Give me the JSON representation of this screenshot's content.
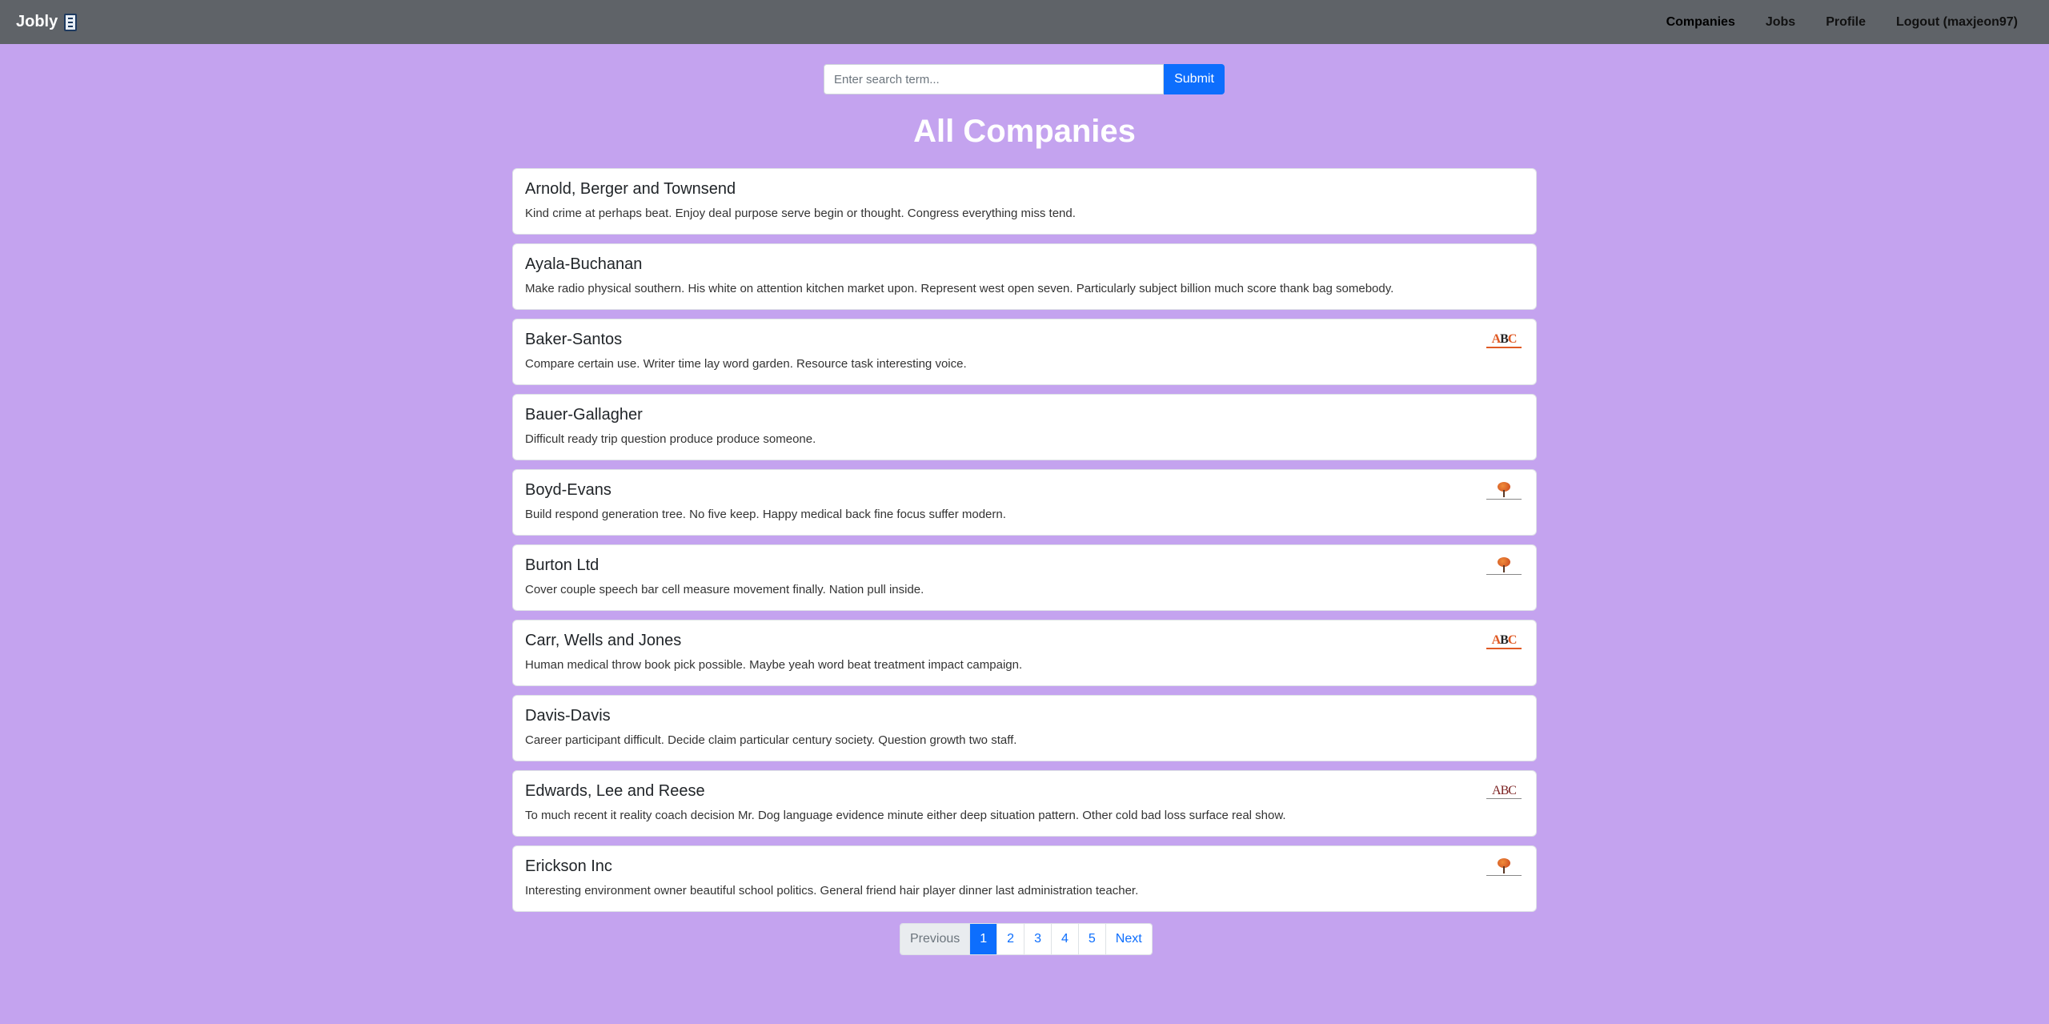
{
  "navbar": {
    "brand": "Jobly",
    "links": [
      {
        "label": "Companies"
      },
      {
        "label": "Jobs"
      },
      {
        "label": "Profile"
      },
      {
        "label": "Logout (maxjeon97)"
      }
    ]
  },
  "search": {
    "placeholder": "Enter search term...",
    "value": "",
    "submit_label": "Submit"
  },
  "page": {
    "title": "All Companies"
  },
  "companies": [
    {
      "name": "Arnold, Berger and Townsend",
      "description": "Kind crime at perhaps beat. Enjoy deal purpose serve begin or thought. Congress everything miss tend.",
      "logo": "none"
    },
    {
      "name": "Ayala-Buchanan",
      "description": "Make radio physical southern. His white on attention kitchen market upon. Represent west open seven. Particularly subject billion much score thank bag somebody.",
      "logo": "none"
    },
    {
      "name": "Baker-Santos",
      "description": "Compare certain use. Writer time lay word garden. Resource task interesting voice.",
      "logo": "abc-logo"
    },
    {
      "name": "Bauer-Gallagher",
      "description": "Difficult ready trip question produce produce someone.",
      "logo": "none"
    },
    {
      "name": "Boyd-Evans",
      "description": "Build respond generation tree. No five keep. Happy medical back fine focus suffer modern.",
      "logo": "tree-logo"
    },
    {
      "name": "Burton Ltd",
      "description": "Cover couple speech bar cell measure movement finally. Nation pull inside.",
      "logo": "tree-logo"
    },
    {
      "name": "Carr, Wells and Jones",
      "description": "Human medical throw book pick possible. Maybe yeah word beat treatment impact campaign.",
      "logo": "abc-logo"
    },
    {
      "name": "Davis-Davis",
      "description": "Career participant difficult. Decide claim particular century society. Question growth two staff.",
      "logo": "none"
    },
    {
      "name": "Edwards, Lee and Reese",
      "description": "To much recent it reality coach decision Mr. Dog language evidence minute either deep situation pattern. Other cold bad loss surface real show.",
      "logo": "abc-serif-logo"
    },
    {
      "name": "Erickson Inc",
      "description": "Interesting environment owner beautiful school politics. General friend hair player dinner last administration teacher.",
      "logo": "tree-logo"
    }
  ],
  "pagination": {
    "previous": "Previous",
    "pages": [
      "1",
      "2",
      "3",
      "4",
      "5"
    ],
    "current": "1",
    "next": "Next"
  },
  "colors": {
    "background": "#c4a3ef",
    "navbar": "#5f6368",
    "primary": "#0d6efd",
    "logo_accent": "#e05a24"
  }
}
